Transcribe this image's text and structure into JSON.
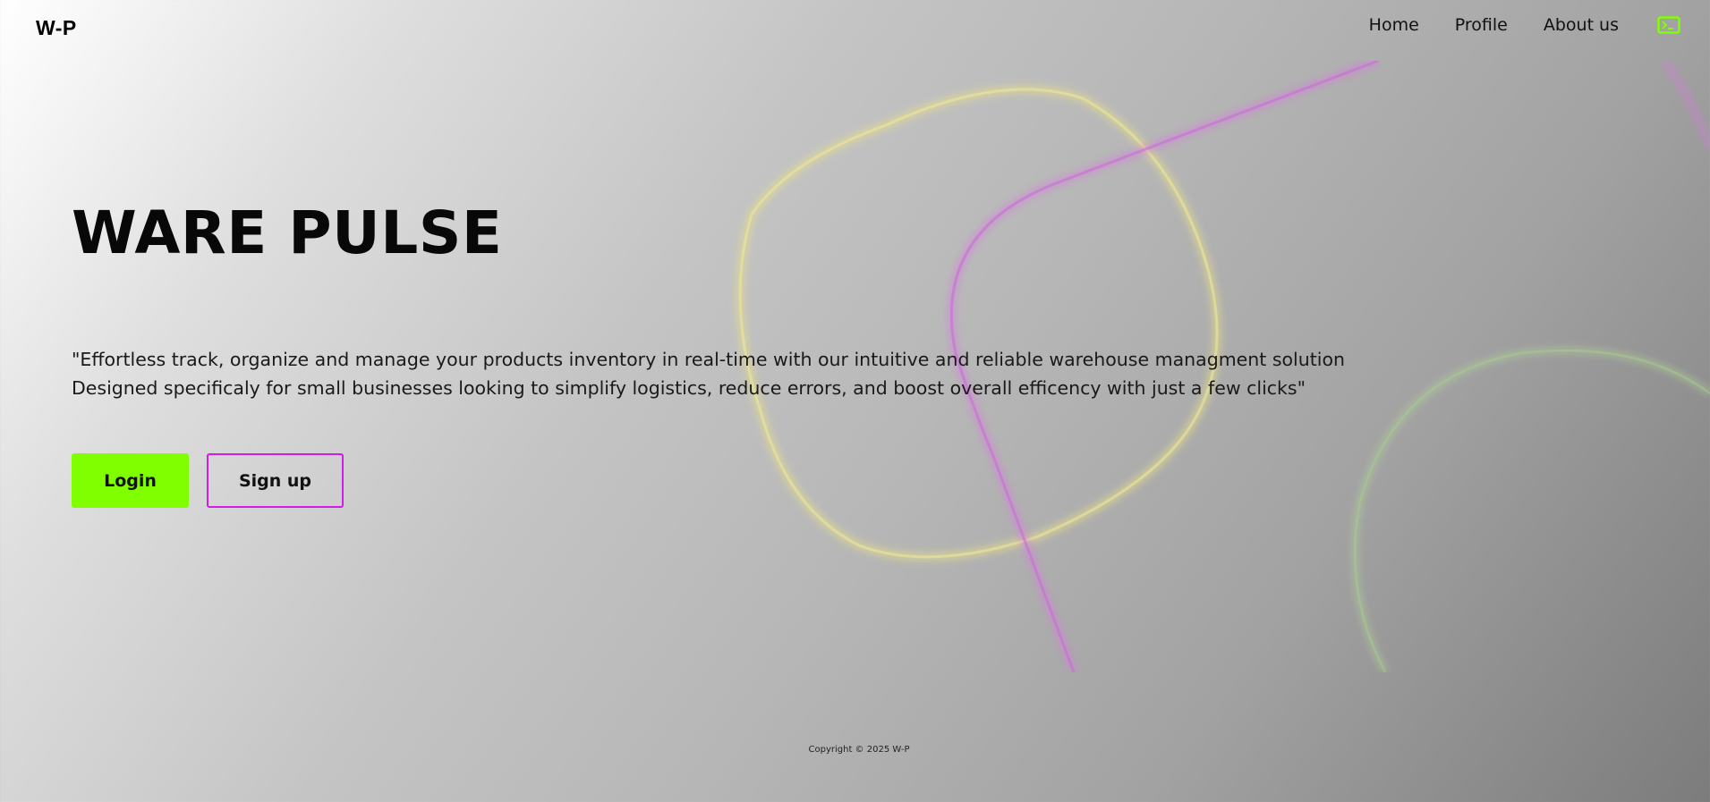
{
  "header": {
    "brand": "W-P",
    "nav": {
      "home": "Home",
      "profile": "Profile",
      "about": "About us",
      "terminal_icon": "terminal-icon"
    }
  },
  "hero": {
    "title": "WARE PULSE",
    "tagline_line1": "\"Effortless track, organize and manage your products inventory in real-time with our intuitive and reliable warehouse managment solution",
    "tagline_line2": "Designed specificaly for small businesses looking to simplify logistics, reduce errors, and boost overall efficency with just a few clicks\"",
    "login_label": "Login",
    "signup_label": "Sign up"
  },
  "footer": {
    "copyright": "Copyright © 2025 W-P"
  },
  "colors": {
    "accent_green": "#7fff00",
    "accent_magenta": "#d21ce8",
    "decor_yellow": "#e6e08a",
    "decor_pink": "#d77ae0",
    "decor_green": "#b4d69a"
  }
}
